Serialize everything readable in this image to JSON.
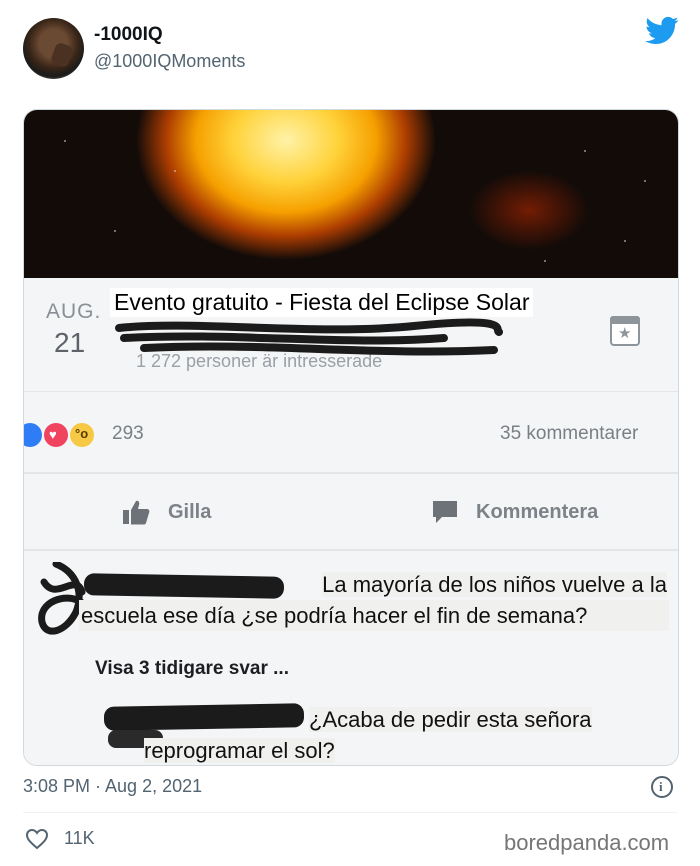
{
  "author": {
    "name": "-1000IQ",
    "handle": "@1000IQMoments"
  },
  "media": {
    "event": {
      "month": "AUG.",
      "day": "21",
      "title": "Evento gratuito - Fiesta del Eclipse Solar",
      "interested": "1 272 personer är intresserade"
    },
    "stats": {
      "reactions": "293",
      "comments": "35 kommentarer"
    },
    "actions": {
      "like": "Gilla",
      "comment": "Kommentera"
    },
    "comment_1": {
      "line1": "La mayoría de los niños vuelve a la",
      "line2": "escuela ese día ¿se podría hacer el fin de semana?"
    },
    "view_replies": "Visa 3 tidigare svar ...",
    "reply": {
      "line1": "¿Acaba de pedir esta señora",
      "line2": "reprogramar el sol?"
    }
  },
  "footer": {
    "timestamp": "3:08 PM · Aug 2, 2021",
    "likes": "11K",
    "watermark": "boredpanda.com"
  },
  "colors": {
    "twitter_blue": "#1d9bf0",
    "secondary_text": "#536471"
  }
}
